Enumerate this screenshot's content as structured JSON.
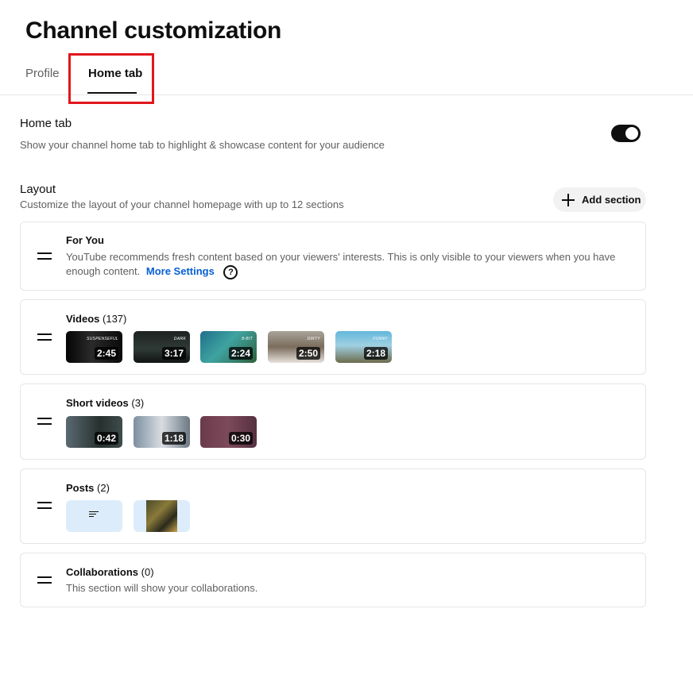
{
  "page": {
    "title": "Channel customization"
  },
  "tabs": [
    {
      "label": "Profile"
    },
    {
      "label": "Home tab"
    }
  ],
  "home_tab": {
    "title": "Home tab",
    "description": "Show your channel home tab to highlight & showcase content for your audience",
    "toggle_on": true
  },
  "layout": {
    "title": "Layout",
    "description": "Customize the layout of your channel homepage with up to 12 sections",
    "add_button": "Add section"
  },
  "sections": {
    "for_you": {
      "title": "For You",
      "description_line1": "YouTube recommends fresh content based on your viewers' interests. This is only visible to your viewers when you have",
      "description_line2": "enough content.",
      "link": "More Settings",
      "help_icon": "?"
    },
    "videos": {
      "title": "Videos",
      "count": "(137)",
      "items": [
        {
          "duration": "2:45",
          "caption": "SUSPENSEFUL"
        },
        {
          "duration": "3:17",
          "caption": "DARK"
        },
        {
          "duration": "2:24",
          "caption": "8-BIT"
        },
        {
          "duration": "2:50",
          "caption": "DIRTY"
        },
        {
          "duration": "2:18",
          "caption": "FUNNY"
        }
      ]
    },
    "shorts": {
      "title": "Short videos",
      "count": "(3)",
      "items": [
        {
          "duration": "0:42"
        },
        {
          "duration": "1:18"
        },
        {
          "duration": "0:30"
        }
      ]
    },
    "posts": {
      "title": "Posts",
      "count": "(2)"
    },
    "collaborations": {
      "title": "Collaborations",
      "count": "(0)",
      "description": "This section will show your collaborations."
    }
  },
  "colors": {
    "accent_link": "#065fd4",
    "highlight_box": "#e0161c",
    "post_tile": "#dcecfb"
  }
}
